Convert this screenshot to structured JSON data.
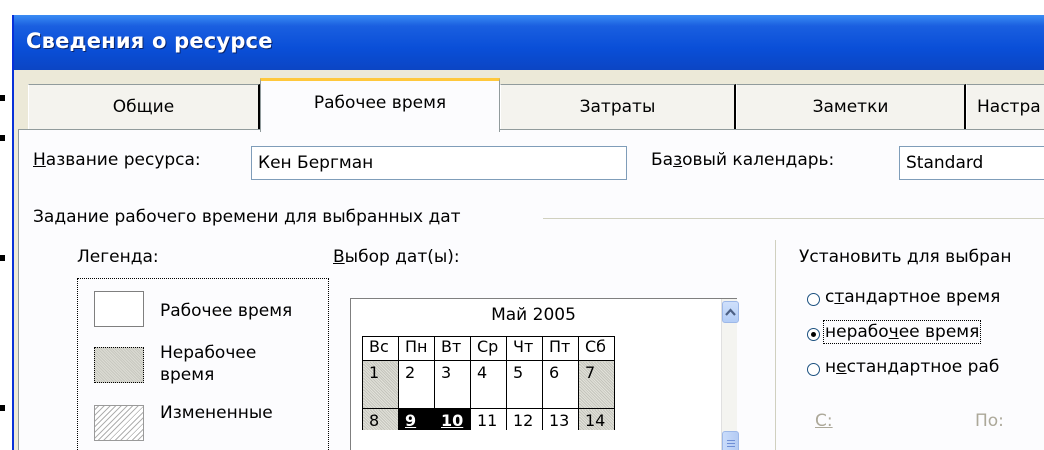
{
  "window": {
    "title": "Сведения о ресурсе"
  },
  "tabs": [
    {
      "label": "Общие",
      "active": false
    },
    {
      "label": "Рабочее время",
      "active": true
    },
    {
      "label": "Затраты",
      "active": false
    },
    {
      "label": "Заметки",
      "active": false
    },
    {
      "label": "Настра",
      "active": false
    }
  ],
  "resource": {
    "name_label_hotkey": "Н",
    "name_label_rest": "азвание ресурса:",
    "name_value": "Кен Бергман",
    "base_cal_label_pre": "Ба",
    "base_cal_label_hotkey": "з",
    "base_cal_label_post": "овый календарь:",
    "base_cal_value": "Standard"
  },
  "group": {
    "title": "Задание рабочего времени для выбранных дат"
  },
  "legend": {
    "title": "Легенда:",
    "working": "Рабочее время",
    "nonworking_1": "Нерабочее",
    "nonworking_2": "время",
    "changed_1": "Измененные"
  },
  "calendar": {
    "label_hotkey": "В",
    "label_rest": "ыбор дат(ы):",
    "month": "Май 2005",
    "weekdays": [
      "Вс",
      "Пн",
      "Вт",
      "Ср",
      "Чт",
      "Пт",
      "Сб"
    ],
    "week1": [
      "1",
      "2",
      "3",
      "4",
      "5",
      "6",
      "7"
    ],
    "week2": [
      "8",
      "9",
      "10",
      "11",
      "12",
      "13",
      "14"
    ]
  },
  "set_for_selected": {
    "title": "Установить для выбран",
    "options": [
      {
        "pre": "с",
        "hotkey": "т",
        "post": "андартное время",
        "checked": false
      },
      {
        "pre": "нерабо",
        "hotkey": "ч",
        "post": "ее время",
        "checked": true
      },
      {
        "pre": "н",
        "hotkey": "е",
        "post": "стандартное раб",
        "checked": false
      }
    ],
    "from_label": "С:",
    "to_label": "По:"
  },
  "colors": {
    "title_bar": "#0a4fd8",
    "dialog_bg": "#ece9d8",
    "panel_bg": "#fcfcfe",
    "active_tab_accent": "#ffc83c"
  }
}
